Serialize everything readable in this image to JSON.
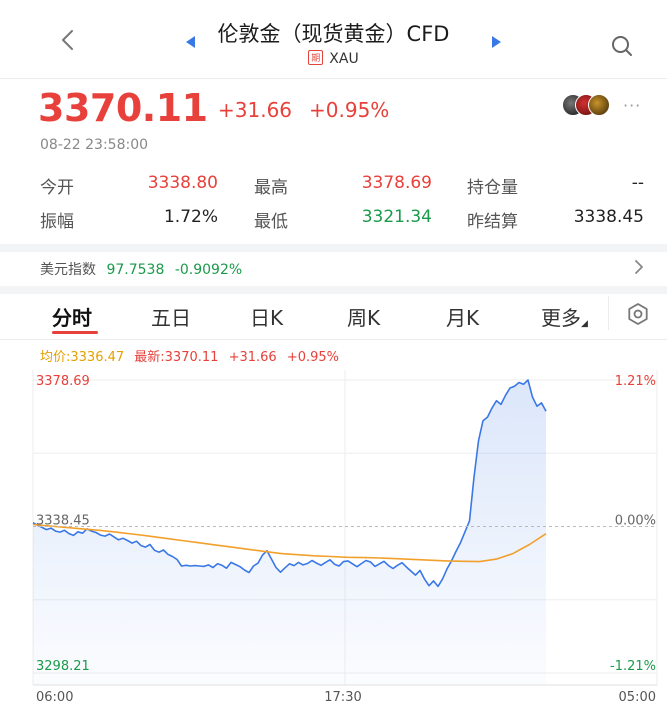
{
  "header": {
    "title": "伦敦金（现货黄金）CFD",
    "badge": "期",
    "symbol": "XAU"
  },
  "quote": {
    "price": "3370.11",
    "change": "+31.66",
    "change_pct": "+0.95%",
    "datetime": "08-22 23:58:00"
  },
  "stats": {
    "open_label": "今开",
    "open_value": "3338.80",
    "high_label": "最高",
    "high_value": "3378.69",
    "oi_label": "持仓量",
    "oi_value": "--",
    "amp_label": "振幅",
    "amp_value": "1.72%",
    "low_label": "最低",
    "low_value": "3321.34",
    "settle_label": "昨结算",
    "settle_value": "3338.45"
  },
  "usd_index": {
    "label": "美元指数",
    "value": "97.7538",
    "change": "-0.9092%"
  },
  "tabs": [
    "分时",
    "五日",
    "日K",
    "周K",
    "月K",
    "更多"
  ],
  "legend": {
    "avg": "均价:3336.47",
    "latest": "最新:3370.11",
    "change": "+31.66",
    "pct": "+0.95%"
  },
  "colors": {
    "up": "#e8403a",
    "down": "#1a9a4a",
    "price_line": "#3a78e6",
    "avg_line": "#f2a02c"
  },
  "chart_data": {
    "type": "line",
    "x_labels": [
      "06:00",
      "17:30",
      "05:00"
    ],
    "y_left_labels": [
      "3378.69",
      "3338.45",
      "3298.21"
    ],
    "y_right_labels": [
      "1.21%",
      "0.00%",
      "-1.21%"
    ],
    "ylim": [
      3298.21,
      3378.69
    ],
    "reference": 3338.45,
    "grid": true,
    "series": [
      {
        "values": [
          3339.5,
          3338.8,
          3338.2,
          3337.6,
          3338.0,
          3337.2,
          3336.9,
          3337.4,
          3336.5,
          3336.0,
          3337.0,
          3336.6,
          3337.8,
          3337.2,
          3336.8,
          3336.1,
          3335.8,
          3336.4,
          3335.6,
          3334.8,
          3335.2,
          3334.6,
          3333.9,
          3334.4,
          3333.2,
          3332.8,
          3333.5,
          3331.9,
          3331.4,
          3332.0,
          3330.8,
          3330.2,
          3329.4,
          3327.6,
          3327.8,
          3327.6,
          3327.7,
          3327.6,
          3327.5,
          3327.9,
          3327.2,
          3328.2,
          3327.8,
          3327.0,
          3328.6,
          3328.0,
          3327.4,
          3326.5,
          3325.8,
          3327.6,
          3328.4,
          3330.6,
          3331.8,
          3329.5,
          3327.2,
          3325.9,
          3327.1,
          3328.2,
          3327.7,
          3328.6,
          3327.9,
          3328.3,
          3329.1,
          3328.4,
          3327.8,
          3328.6,
          3329.3,
          3328.1,
          3327.6,
          3328.8,
          3329.0,
          3328.2,
          3327.4,
          3328.3,
          3329.1,
          3328.7,
          3327.5,
          3328.2,
          3328.9,
          3327.7,
          3326.9,
          3327.8,
          3328.5,
          3327.3,
          3326.2,
          3325.1,
          3326.4,
          3324.0,
          3322.2,
          3323.5,
          3322.0,
          3324.0,
          3326.8,
          3329.0,
          3331.6,
          3334.0,
          3337.0,
          3340.0,
          3352.0,
          3362.0,
          3367.5,
          3368.5,
          3371.0,
          3373.0,
          3372.0,
          3374.5,
          3376.5,
          3377.0,
          3378.0,
          3377.5,
          3378.69,
          3374.0,
          3371.5,
          3372.4,
          3370.11
        ]
      },
      {
        "values": [
          3339.0,
          3338.6,
          3338.2,
          3337.8,
          3337.4,
          3336.9,
          3336.4,
          3335.8,
          3335.2,
          3334.6,
          3334.0,
          3333.4,
          3332.8,
          3332.2,
          3331.6,
          3331.0,
          3330.7,
          3330.4,
          3330.2,
          3330.0,
          3329.9,
          3329.8,
          3329.6,
          3329.4,
          3329.2,
          3329.0,
          3328.9,
          3328.8,
          3329.5,
          3331.0,
          3333.5,
          3336.47
        ]
      }
    ]
  }
}
